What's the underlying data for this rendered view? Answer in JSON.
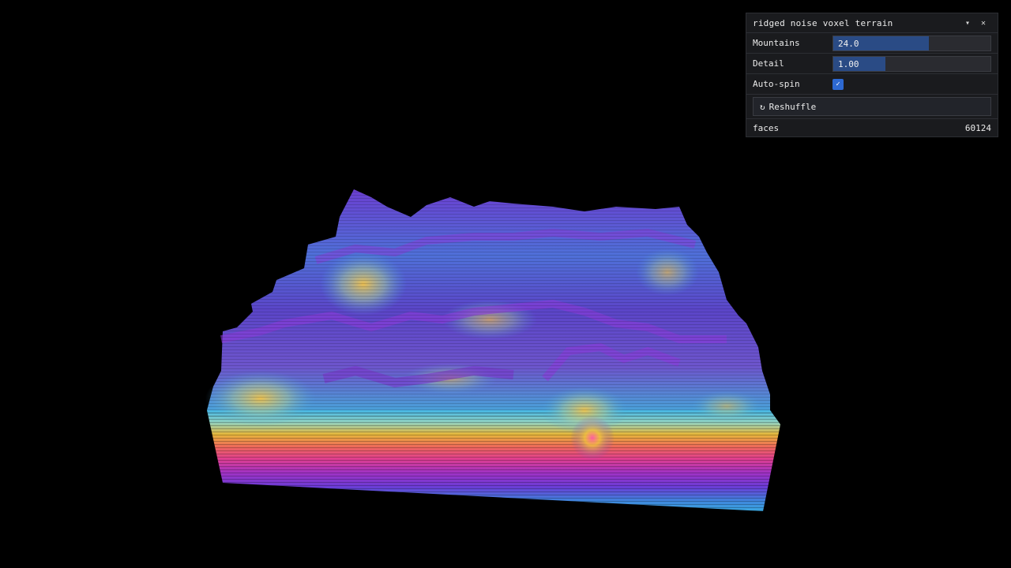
{
  "panel": {
    "title": "ridged noise voxel terrain",
    "collapse_icon": "chevron-down-icon",
    "close_icon": "close-icon",
    "collapse_glyph": "▾",
    "close_glyph": "✕",
    "mountains": {
      "label": "Mountains",
      "value": "24.0",
      "fill_fraction": 0.61
    },
    "detail": {
      "label": "Detail",
      "value": "1.00",
      "fill_fraction": 0.33
    },
    "auto_spin": {
      "label": "Auto-spin",
      "checked": true,
      "glyph": "✓"
    },
    "reshuffle": {
      "label": "Reshuffle",
      "icon": "refresh-icon",
      "glyph": "↻"
    },
    "faces": {
      "label": "faces",
      "value": "60124"
    }
  },
  "colors": {
    "background": "#000000",
    "panel_bg": "#1a1b1e",
    "slider_fill": "#2a4b85",
    "checkbox": "#2d69d2",
    "terrain_gradient": [
      "#42b8e6",
      "#e8b93a",
      "#e6408a",
      "#7b2fc9",
      "#3a8fe0"
    ]
  }
}
